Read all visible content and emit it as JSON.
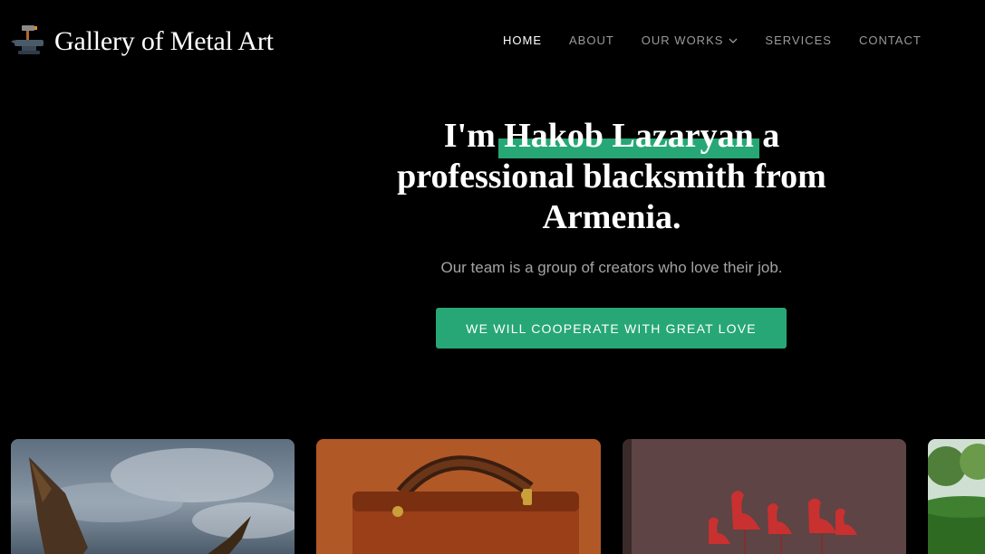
{
  "site": {
    "logo_text": "Gallery of Metal Art",
    "logo_icon": "anvil-hammer-icon"
  },
  "nav": {
    "items": [
      {
        "label": "HOME",
        "active": true
      },
      {
        "label": "ABOUT",
        "active": false
      },
      {
        "label": "OUR WORKS",
        "active": false,
        "has_dropdown": true
      },
      {
        "label": "SERVICES",
        "active": false
      },
      {
        "label": "CONTACT",
        "active": false
      }
    ]
  },
  "hero": {
    "title_prefix": "I'm",
    "title_highlight": "Hakob Lazaryan",
    "title_line1_suffix": "a",
    "title_rest": "professional blacksmith from Armenia.",
    "subtitle": "Our team is a group of creators who love their job.",
    "cta_label": "WE WILL COOPERATE WITH GREAT LOVE"
  },
  "gallery": {
    "cards": [
      {
        "subject": "metal eagle sculpture"
      },
      {
        "subject": "leather bag"
      },
      {
        "subject": "metal flamingo wall art"
      },
      {
        "subject": "garden greenery"
      }
    ]
  },
  "colors": {
    "accent": "#27a776",
    "background": "#000000",
    "nav_inactive": "#9a9a9a",
    "subtitle": "#a3a3a3"
  }
}
